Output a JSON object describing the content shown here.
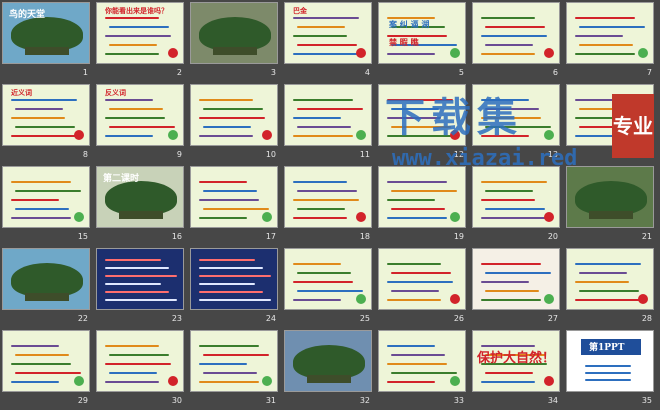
{
  "slides": [
    {
      "n": "1",
      "kind": "tree",
      "bg": "#6fa8c8",
      "title": "鸟的天堂"
    },
    {
      "n": "2",
      "kind": "text",
      "bg": "#eef5d8",
      "title": "你能看出来是谁吗？"
    },
    {
      "n": "3",
      "kind": "tree",
      "bg": "#7d8a6a",
      "title": ""
    },
    {
      "n": "4",
      "kind": "text",
      "bg": "#eef5d8",
      "title": "巴金"
    },
    {
      "n": "5",
      "kind": "words",
      "bg": "#eef5d8",
      "title": "",
      "words": [
        "案  纠  逼  湖",
        "禁  暇  瞧"
      ]
    },
    {
      "n": "6",
      "kind": "text",
      "bg": "#eef5d8",
      "title": ""
    },
    {
      "n": "7",
      "kind": "text",
      "bg": "#eef5d8",
      "title": ""
    },
    {
      "n": "8",
      "kind": "text",
      "bg": "#eef5d8",
      "title": "近义词"
    },
    {
      "n": "9",
      "kind": "text",
      "bg": "#eef5d8",
      "title": "反义词"
    },
    {
      "n": "10",
      "kind": "text",
      "bg": "#eef5d8",
      "title": ""
    },
    {
      "n": "11",
      "kind": "text",
      "bg": "#eef5d8",
      "title": ""
    },
    {
      "n": "12",
      "kind": "text",
      "bg": "#eef5d8",
      "title": ""
    },
    {
      "n": "13",
      "kind": "text",
      "bg": "#eef5d8",
      "title": ""
    },
    {
      "n": "14",
      "kind": "text",
      "bg": "#eef5d8",
      "title": ""
    },
    {
      "n": "15",
      "kind": "text",
      "bg": "#eef5d8",
      "title": ""
    },
    {
      "n": "16",
      "kind": "tree",
      "bg": "#c8d2b8",
      "title": "第二课时"
    },
    {
      "n": "17",
      "kind": "text",
      "bg": "#eef5d8",
      "title": ""
    },
    {
      "n": "18",
      "kind": "text",
      "bg": "#eef5d8",
      "title": ""
    },
    {
      "n": "19",
      "kind": "text",
      "bg": "#eef5d8",
      "title": ""
    },
    {
      "n": "20",
      "kind": "text",
      "bg": "#eef5d8",
      "title": ""
    },
    {
      "n": "21",
      "kind": "tree",
      "bg": "#5d7a4a",
      "title": ""
    },
    {
      "n": "22",
      "kind": "tree",
      "bg": "#6fa8c8",
      "title": ""
    },
    {
      "n": "23",
      "kind": "dark",
      "bg": "#1c2f6f",
      "title": ""
    },
    {
      "n": "24",
      "kind": "dark",
      "bg": "#1c2f6f",
      "title": ""
    },
    {
      "n": "25",
      "kind": "text",
      "bg": "#eef5d8",
      "title": ""
    },
    {
      "n": "26",
      "kind": "text",
      "bg": "#eef5d8",
      "title": ""
    },
    {
      "n": "27",
      "kind": "text",
      "bg": "#f5f0e6",
      "title": ""
    },
    {
      "n": "28",
      "kind": "text",
      "bg": "#eef5d8",
      "title": ""
    },
    {
      "n": "29",
      "kind": "text",
      "bg": "#eef5d8",
      "title": ""
    },
    {
      "n": "30",
      "kind": "text",
      "bg": "#eef5d8",
      "title": ""
    },
    {
      "n": "31",
      "kind": "text",
      "bg": "#eef5d8",
      "title": ""
    },
    {
      "n": "32",
      "kind": "tree",
      "bg": "#6f8fb0",
      "title": ""
    },
    {
      "n": "33",
      "kind": "text",
      "bg": "#eef5d8",
      "title": ""
    },
    {
      "n": "34",
      "kind": "slogan",
      "bg": "#eef5d8",
      "title": "保护大自然！"
    },
    {
      "n": "35",
      "kind": "ppt",
      "bg": "#ffffff",
      "title": "第1PPT"
    }
  ],
  "watermark": {
    "text": "下载集",
    "url": "www.xiazai.red",
    "badge": "专业"
  },
  "colors": {
    "desktop": "#474747",
    "accent_red": "#c0392b",
    "accent_blue": "#2d6fbf",
    "title_red": "#d2232a"
  }
}
